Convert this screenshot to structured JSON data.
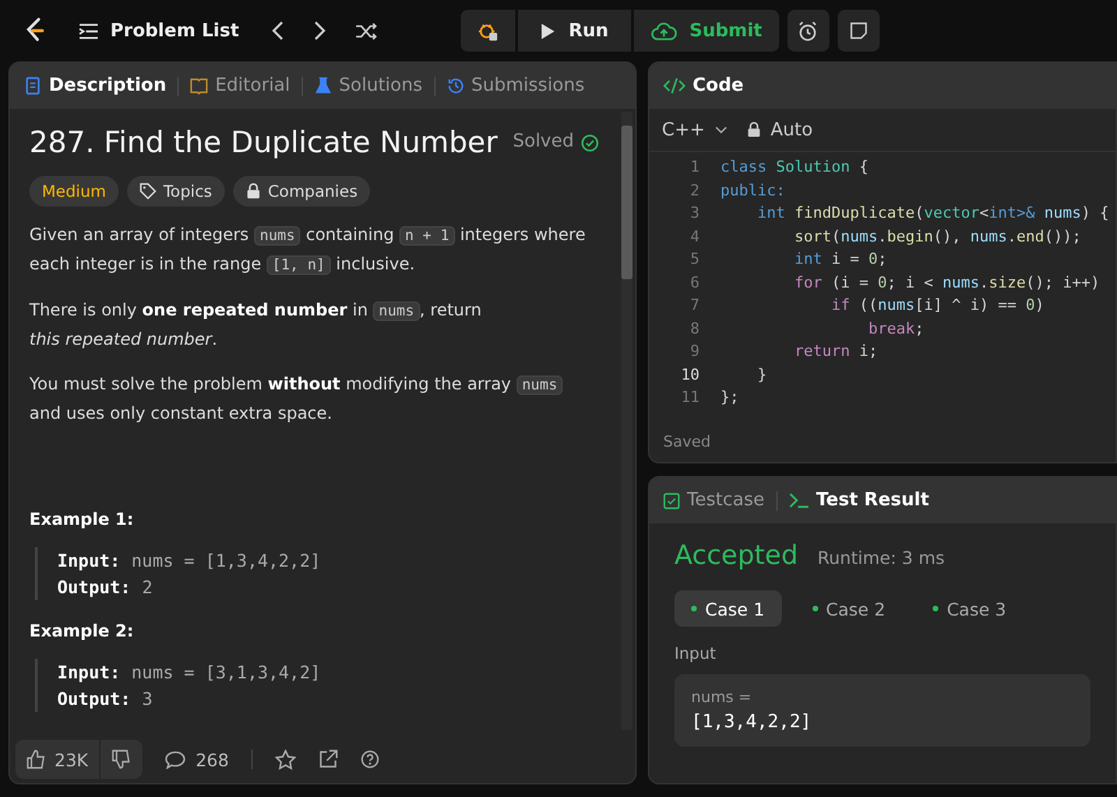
{
  "top_bar": {
    "problem_list": "Problem List",
    "run": "Run",
    "submit": "Submit"
  },
  "description_panel": {
    "tabs": [
      {
        "label": "Description",
        "selected": true
      },
      {
        "label": "Editorial",
        "selected": false
      },
      {
        "label": "Solutions",
        "selected": false
      },
      {
        "label": "Submissions",
        "selected": false
      }
    ],
    "title": "287. Find the Duplicate Number",
    "status": "Solved",
    "tags": [
      {
        "label": "Medium",
        "kind": "difficulty",
        "color": "#ffb800"
      },
      {
        "label": "Topics",
        "kind": "topics"
      },
      {
        "label": "Companies",
        "kind": "companies"
      }
    ],
    "paragraphs": [
      [
        {
          "text": "Given an array of integers ",
          "kind": "plain"
        },
        {
          "text": "nums",
          "kind": "code"
        },
        {
          "text": " containing ",
          "kind": "plain"
        },
        {
          "text": "n + 1",
          "kind": "code"
        },
        {
          "text": " integers where each integer is in the range ",
          "kind": "plain"
        },
        {
          "text": "[1, n]",
          "kind": "code"
        },
        {
          "text": " inclusive.",
          "kind": "plain"
        }
      ],
      [
        {
          "text": "There is only ",
          "kind": "plain"
        },
        {
          "text": "one repeated number",
          "kind": "bold"
        },
        {
          "text": " in ",
          "kind": "plain"
        },
        {
          "text": "nums",
          "kind": "code"
        },
        {
          "text": ", return",
          "kind": "plain"
        },
        {
          "text": "this repeated number",
          "kind": "italic_break"
        },
        {
          "text": ".",
          "kind": "plain"
        }
      ],
      [
        {
          "text": "You must solve the problem ",
          "kind": "plain"
        },
        {
          "text": "without",
          "kind": "bold"
        },
        {
          "text": " modifying the array ",
          "kind": "plain"
        },
        {
          "text": "nums",
          "kind": "code"
        },
        {
          "text": " and uses only constant extra space.",
          "kind": "plain"
        }
      ]
    ],
    "examples": [
      {
        "title": "Example 1:",
        "input_label": "Input:",
        "input": "nums = [1,3,4,2,2]",
        "output_label": "Output:",
        "output": "2"
      },
      {
        "title": "Example 2:",
        "input_label": "Input:",
        "input": "nums = [3,1,3,4,2]",
        "output_label": "Output:",
        "output": "3"
      }
    ],
    "footer": {
      "likes": "23K",
      "comments": "268"
    }
  },
  "code_panel": {
    "title": "Code",
    "language": "C++",
    "mode": "Auto",
    "status": "Saved",
    "lines": [
      {
        "number": "1",
        "active": false,
        "tokens": [
          {
            "text": "class",
            "kind": "kw"
          },
          {
            "text": " Solution",
            "kind": "type"
          },
          {
            "text": " {",
            "kind": "plain"
          }
        ]
      },
      {
        "number": "2",
        "active": false,
        "tokens": [
          {
            "text": "public:",
            "kind": "kw"
          }
        ]
      },
      {
        "number": "3",
        "active": false,
        "tokens": [
          {
            "text": "    int",
            "kind": "kw"
          },
          {
            "text": " findDuplicate",
            "kind": "fn"
          },
          {
            "text": "(",
            "kind": "plain"
          },
          {
            "text": "vector",
            "kind": "type"
          },
          {
            "text": "<",
            "kind": "plain"
          },
          {
            "text": "int",
            "kind": "kw"
          },
          {
            "text": ">&",
            "kind": "kw"
          },
          {
            "text": " nums",
            "kind": "var"
          },
          {
            "text": ") {",
            "kind": "plain"
          }
        ]
      },
      {
        "number": "4",
        "active": false,
        "tokens": [
          {
            "text": "        sort",
            "kind": "fn"
          },
          {
            "text": "(",
            "kind": "plain"
          },
          {
            "text": "nums",
            "kind": "var"
          },
          {
            "text": ".",
            "kind": "plain"
          },
          {
            "text": "begin",
            "kind": "fn"
          },
          {
            "text": "(), ",
            "kind": "plain"
          },
          {
            "text": "nums",
            "kind": "var"
          },
          {
            "text": ".",
            "kind": "plain"
          },
          {
            "text": "end",
            "kind": "fn"
          },
          {
            "text": "());",
            "kind": "plain"
          }
        ]
      },
      {
        "number": "5",
        "active": false,
        "tokens": [
          {
            "text": "        int",
            "kind": "kw"
          },
          {
            "text": " i = ",
            "kind": "plain"
          },
          {
            "text": "0",
            "kind": "num"
          },
          {
            "text": ";",
            "kind": "plain"
          }
        ]
      },
      {
        "number": "6",
        "active": false,
        "tokens": [
          {
            "text": "        for",
            "kind": "ctrl"
          },
          {
            "text": " (i = ",
            "kind": "plain"
          },
          {
            "text": "0",
            "kind": "num"
          },
          {
            "text": "; i < ",
            "kind": "plain"
          },
          {
            "text": "nums",
            "kind": "var"
          },
          {
            "text": ".",
            "kind": "plain"
          },
          {
            "text": "size",
            "kind": "fn"
          },
          {
            "text": "(); i++)",
            "kind": "plain"
          }
        ]
      },
      {
        "number": "7",
        "active": false,
        "tokens": [
          {
            "text": "            if",
            "kind": "ctrl"
          },
          {
            "text": " ((",
            "kind": "plain"
          },
          {
            "text": "nums",
            "kind": "var"
          },
          {
            "text": "[i] ^ i) == ",
            "kind": "plain"
          },
          {
            "text": "0",
            "kind": "num"
          },
          {
            "text": ")",
            "kind": "plain"
          }
        ]
      },
      {
        "number": "8",
        "active": false,
        "tokens": [
          {
            "text": "                break",
            "kind": "ctrl"
          },
          {
            "text": ";",
            "kind": "plain"
          }
        ]
      },
      {
        "number": "9",
        "active": false,
        "tokens": [
          {
            "text": "        return",
            "kind": "ctrl"
          },
          {
            "text": " i;",
            "kind": "plain"
          }
        ]
      },
      {
        "number": "10",
        "active": true,
        "tokens": [
          {
            "text": "    }",
            "kind": "plain"
          }
        ]
      },
      {
        "number": "11",
        "active": false,
        "tokens": [
          {
            "text": "};",
            "kind": "plain"
          }
        ]
      }
    ]
  },
  "result_panel": {
    "tabs": [
      {
        "label": "Testcase",
        "selected": false
      },
      {
        "label": "Test Result",
        "selected": true
      }
    ],
    "verdict": "Accepted",
    "runtime": "Runtime: 3 ms",
    "cases": [
      {
        "label": "Case 1",
        "selected": true
      },
      {
        "label": "Case 2",
        "selected": false
      },
      {
        "label": "Case 3",
        "selected": false
      }
    ],
    "input_heading": "Input",
    "variable": "nums =",
    "value": "[1,3,4,2,2]"
  }
}
